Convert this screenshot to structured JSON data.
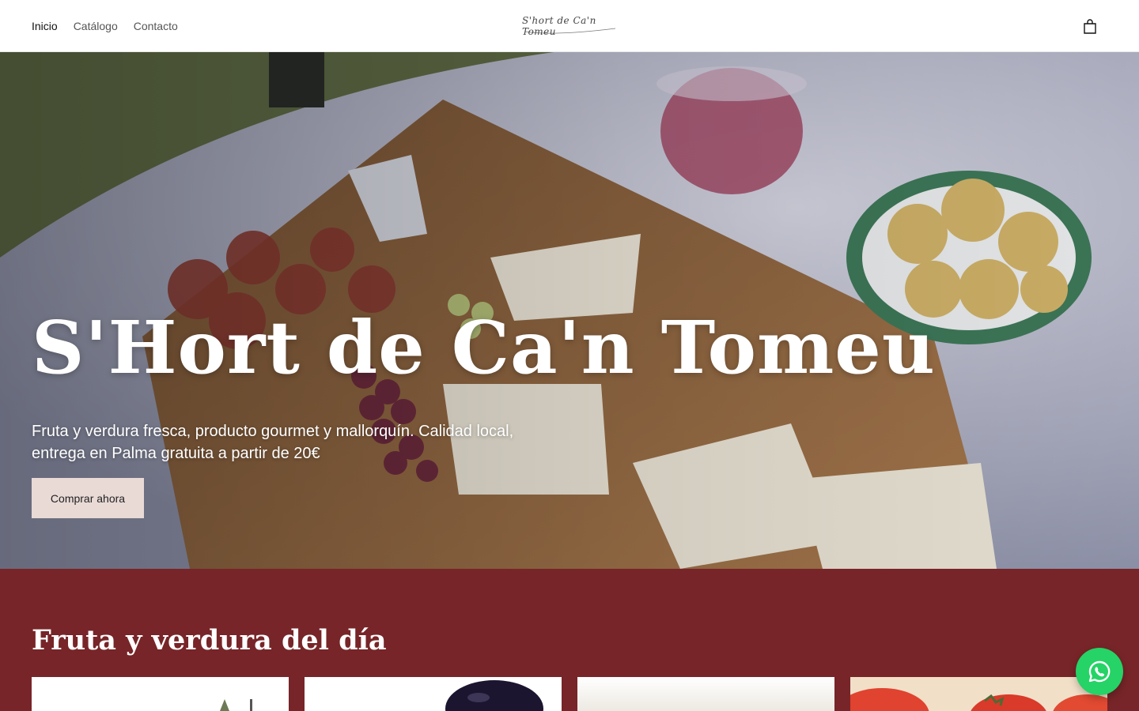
{
  "nav": {
    "items": [
      {
        "label": "Inicio",
        "active": true
      },
      {
        "label": "Catálogo",
        "active": false
      },
      {
        "label": "Contacto",
        "active": false
      }
    ]
  },
  "logo": {
    "text": "S'hort de Ca'n Tomeu"
  },
  "header": {
    "cart_icon": "shopping-bag-icon"
  },
  "hero": {
    "title": "S'Hort de Ca'n Tomeu",
    "subtitle": "Fruta y verdura fresca, producto gourmet y mallorquín. Calidad local, entrega en Palma gratuita a partir de 20€",
    "cta_label": "Comprar ahora",
    "image": "picnic-cheese-charcuterie-image"
  },
  "products": {
    "heading": "Fruta y verdura del día",
    "cards": [
      {
        "image": "product-image-1"
      },
      {
        "image": "eggplant-image"
      },
      {
        "image": "product-image-3"
      },
      {
        "image": "tomatoes-image"
      }
    ]
  },
  "colors": {
    "section_bg": "#772528",
    "cta_bg": "#e9dad6",
    "whatsapp": "#25d366"
  },
  "floating": {
    "whatsapp_icon": "whatsapp-icon"
  }
}
